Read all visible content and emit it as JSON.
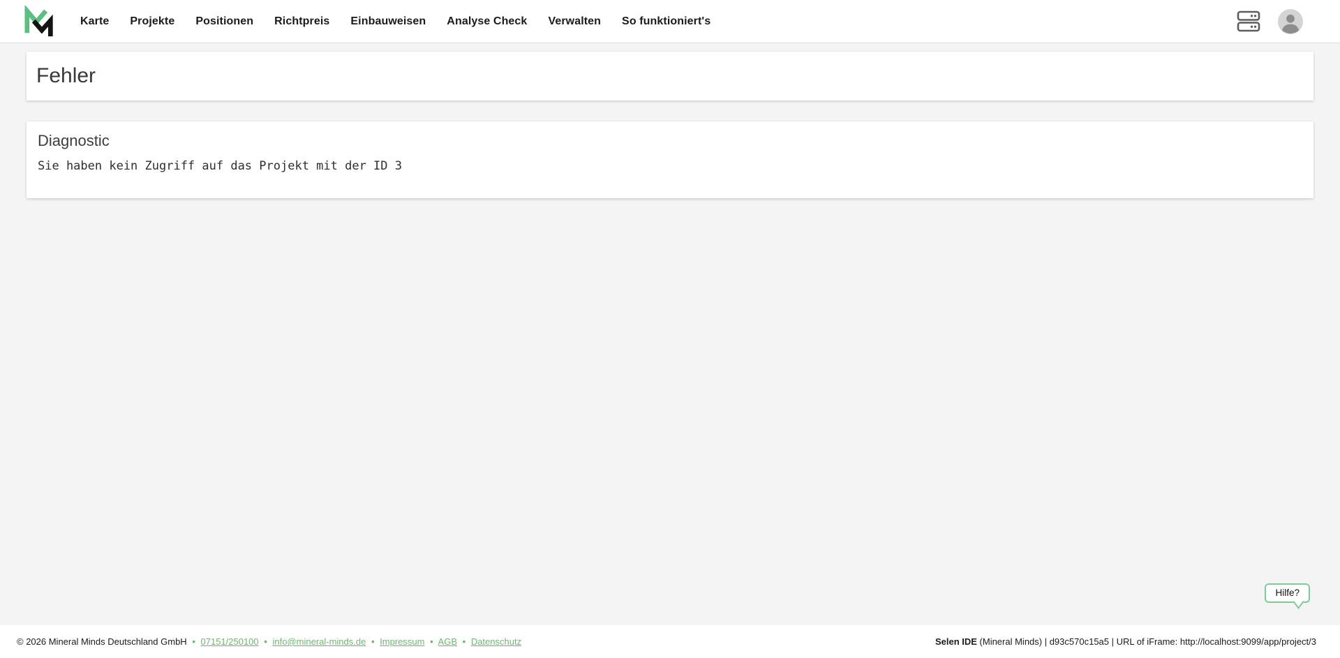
{
  "header": {
    "nav": [
      "Karte",
      "Projekte",
      "Positionen",
      "Richtpreis",
      "Einbauweisen",
      "Analyse Check",
      "Verwalten",
      "So funktioniert's"
    ],
    "icons": [
      "mineral-minds-logo",
      "dns-server-icon",
      "user-avatar-icon"
    ]
  },
  "error_card": {
    "title": "Fehler"
  },
  "diagnostic_card": {
    "title": "Diagnostic",
    "message": "Sie haben kein Zugriff auf das Projekt mit der ID 3"
  },
  "help_bubble": {
    "label": "Hilfe?"
  },
  "footer": {
    "separator": "•",
    "left": {
      "copyright": "© 2026 Mineral Minds Deutschland GmbH",
      "links": [
        "07151/250100",
        "info@mineral-minds.de",
        "Impressum",
        "AGB",
        "Datenschutz"
      ]
    },
    "right": {
      "bold": "Selen IDE",
      "rest": " (Mineral Minds) | d93c570c15a5 | URL of iFrame: http://localhost:9099/app/project/3"
    }
  },
  "colors": {
    "logo_green": "#5dbe82",
    "logo_black": "#141414",
    "link_green": "#66bb6a",
    "help_border_green": "#7ecb96",
    "page_background": "#f4f4f4",
    "header_background": "#ffffff",
    "icon_gray": "#5d5d5d",
    "avatar_circle": "#d4d4d4",
    "avatar_person": "#8d8d8d",
    "title_text": "#383838"
  }
}
